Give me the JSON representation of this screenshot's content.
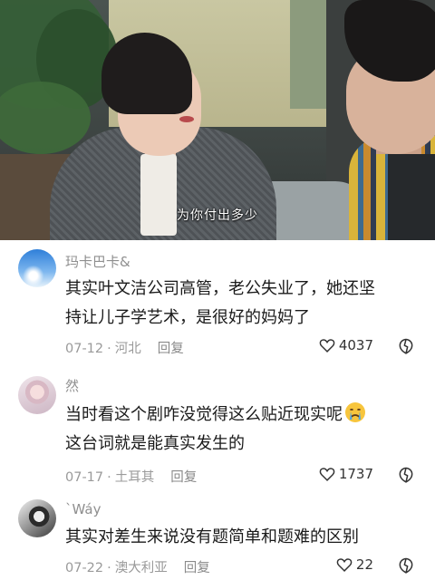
{
  "video": {
    "subtitle": "为你付出多少"
  },
  "comments": [
    {
      "username": "玛卡巴卡&",
      "avatar_icon": "sky-avatar",
      "lines": [
        "其实叶文洁公司高管，老公失业了，她还坚",
        "持让儿子学艺术，是很好的妈妈了"
      ],
      "date": "07-12",
      "location": "河北",
      "reply_label": "回复",
      "likes": "4037"
    },
    {
      "username": "然",
      "avatar_icon": "anime-girl-avatar",
      "lines": [
        "当时看这个剧咋没觉得这么贴近现实呢",
        "这台词就是能真实发生的"
      ],
      "emoji": "crying-face-icon",
      "date": "07-17",
      "location": "土耳其",
      "reply_label": "回复",
      "likes": "1737"
    },
    {
      "username": "`Wáy",
      "avatar_icon": "portrait-avatar",
      "lines": [
        "其实对差生来说没有题简单和题难的区别"
      ],
      "date": "07-22",
      "location": "澳大利亚",
      "reply_label": "回复",
      "likes": "22"
    }
  ],
  "colors": {
    "text": "#1a1a1a",
    "muted": "#9a9a9a"
  }
}
